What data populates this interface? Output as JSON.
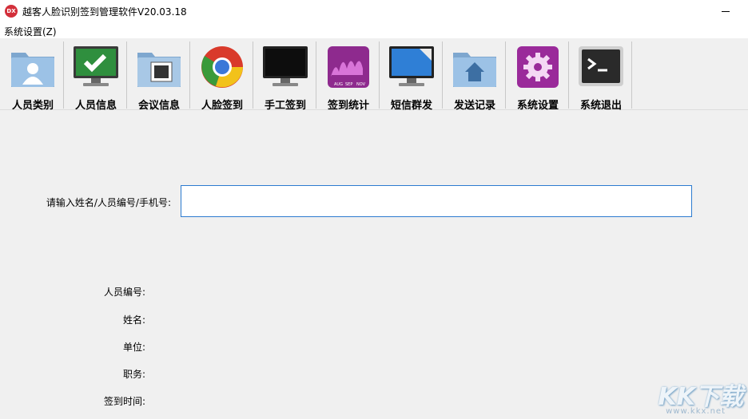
{
  "window": {
    "icon_text": "DX",
    "title": "越客人脸识别签到管理软件V20.03.18"
  },
  "menu": {
    "system_settings": "系统设置(Z)"
  },
  "toolbar": {
    "items": [
      {
        "label": "人员类别",
        "icon": "person-folder-icon"
      },
      {
        "label": "人员信息",
        "icon": "check-monitor-icon"
      },
      {
        "label": "会议信息",
        "icon": "photo-folder-icon"
      },
      {
        "label": "人脸签到",
        "icon": "chrome-ball-icon"
      },
      {
        "label": "手工签到",
        "icon": "black-monitor-icon"
      },
      {
        "label": "签到统计",
        "icon": "chart-tile-icon"
      },
      {
        "label": "短信群发",
        "icon": "blue-monitor-icon"
      },
      {
        "label": "发送记录",
        "icon": "home-folder-icon"
      },
      {
        "label": "系统设置",
        "icon": "gear-tile-icon"
      },
      {
        "label": "系统退出",
        "icon": "terminal-icon"
      }
    ],
    "chart_tile_ticks": [
      "AUG",
      "SEP",
      "NOV"
    ]
  },
  "search": {
    "label": "请输入姓名/人员编号/手机号:",
    "value": ""
  },
  "info": {
    "employee_id_label": "人员编号:",
    "name_label": "姓名:",
    "unit_label": "单位:",
    "position_label": "职务:",
    "checkin_time_label": "签到时间:"
  },
  "watermark": {
    "big": "KK下载",
    "small": "www.kkx.net"
  },
  "colors": {
    "accent_border": "#2c7bd0",
    "app_icon": "#d32f3a"
  }
}
